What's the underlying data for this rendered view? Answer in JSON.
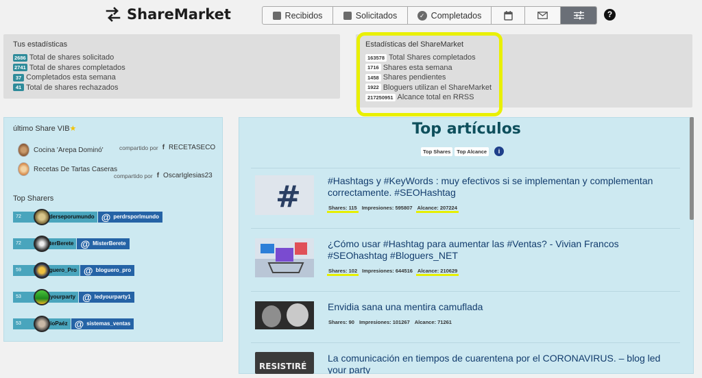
{
  "app": {
    "title": "ShareMarket"
  },
  "nav": {
    "recibidos": "Recibidos",
    "solicitados": "Solicitados",
    "completados": "Completados",
    "help": "?"
  },
  "user_stats": {
    "title": "Tus estadísticas",
    "rows": [
      {
        "value": "2686",
        "label": "Total de shares solicitado"
      },
      {
        "value": "2741",
        "label": "Total de shares completados"
      },
      {
        "value": "37",
        "label": "Completados esta semana"
      },
      {
        "value": "41",
        "label": "Total de shares rechazados"
      }
    ]
  },
  "market_stats": {
    "title": "Estadísticas del ShareMarket",
    "rows": [
      {
        "value": "163578",
        "label": "Total Shares completados"
      },
      {
        "value": "1716",
        "label": "Shares esta semana"
      },
      {
        "value": "1458",
        "label": "Shares pendientes"
      },
      {
        "value": "1922",
        "label": "Bloguers utilizan el ShareMarket"
      },
      {
        "value": "217250951",
        "label": "Alcance total en RRSS"
      }
    ]
  },
  "vib": {
    "title": "último Share VIB",
    "star": "★",
    "items": [
      {
        "title": "Cocina 'Arepa Dominó'",
        "shared_by": "compartido por",
        "fb": "f",
        "user": "RECETASECO"
      },
      {
        "title": "Recetas De Tartas Caseras",
        "shared_by": "compartido por",
        "fb": "f",
        "user": "OscarIglesias23"
      }
    ]
  },
  "top_sharers": {
    "title": "Top Sharers",
    "at": "@",
    "items": [
      {
        "num": "72",
        "name": "Perderseporumundo",
        "twitter": "perdrsporlmundo"
      },
      {
        "num": "72",
        "name": "MisterBerete",
        "twitter": "MisterBerete"
      },
      {
        "num": "59",
        "name": "Bloguero_Pro",
        "twitter": "bloguero_pro"
      },
      {
        "num": "53",
        "name": "Ledyourparty",
        "twitter": "ledyourparty1"
      },
      {
        "num": "53",
        "name": "MarioPaéz",
        "twitter": "sistemas_ventas"
      }
    ]
  },
  "top_articles": {
    "title": "Top artículos",
    "filters": [
      "Top Shares",
      "Top Alcance"
    ],
    "info": "i",
    "items": [
      {
        "title": "#Hashtags y #KeyWords : muy efectivos si se implementan y complementan correctamente. #SEOHashtag",
        "shares": "Shares: 115",
        "impresiones": "Impresiones: 595807",
        "alcance": "Alcance: 207224"
      },
      {
        "title": "¿Cómo usar #Hashtag para aumentar las #Ventas? - Vivian Francos #SEOhashtag #Bloguers_NET",
        "shares": "Shares: 102",
        "impresiones": "Impresiones: 644516",
        "alcance": "Alcance: 210629"
      },
      {
        "title": "Envidia sana una mentira camuflada",
        "shares": "Shares: 90",
        "impresiones": "Impresiones: 101267",
        "alcance": "Alcance: 71261"
      },
      {
        "title": "La comunicación en tiempos de cuarentena por el CORONAVIRUS. – blog led your party",
        "thumb_text": "RESISTIRÉ"
      }
    ]
  }
}
